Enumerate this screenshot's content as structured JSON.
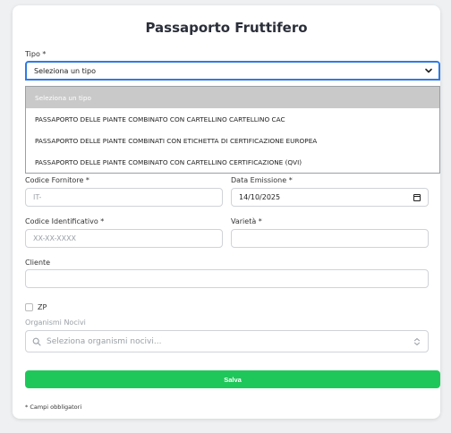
{
  "title": "Passaporto Fruttifero",
  "tipo": {
    "label": "Tipo *",
    "selected": "Seleziona un tipo",
    "options": [
      "Seleziona un tipo",
      "PASSAPORTO DELLE PIANTE COMBINATO CON CARTELLINO CARTELLINO CAC",
      "PASSAPORTO DELLE PIANTE COMBINATI CON ETICHETTA DI CERTIFICAZIONE EUROPEA",
      "PASSAPORTO DELLE PIANTE COMBINATO CON CARTELLINO CERTIFICAZIONE (QVI)"
    ]
  },
  "codice_fornitore": {
    "label": "Codice Fornitore *",
    "placeholder": "IT-"
  },
  "data_emissione": {
    "label": "Data Emissione *",
    "value": "14/10/2025"
  },
  "codice_identificativo": {
    "label": "Codice Identificativo *",
    "placeholder": "XX-XX-XXXX"
  },
  "varieta": {
    "label": "Varietà *",
    "value": ""
  },
  "cliente": {
    "label": "Cliente",
    "value": ""
  },
  "zp": {
    "label": "ZP",
    "checked": false
  },
  "organismi": {
    "label": "Organismi Nocivi",
    "placeholder": "Seleziona organismi nocivi..."
  },
  "submit_label": "Salva",
  "note": "* Campi obbligatori",
  "colors": {
    "accent": "#2f7be5",
    "primary_button": "#1fc75a"
  }
}
